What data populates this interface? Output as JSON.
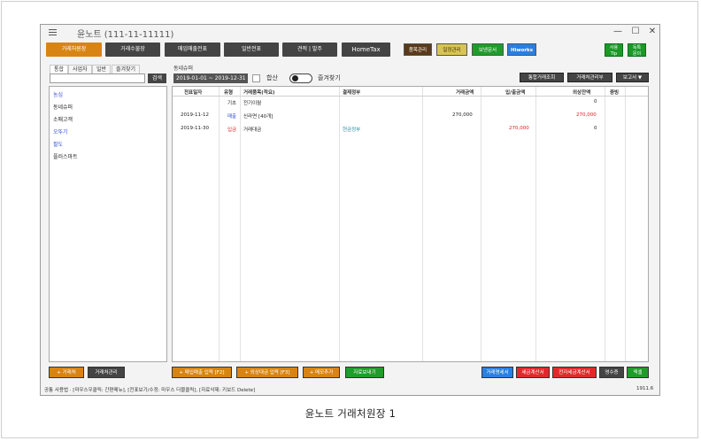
{
  "window": {
    "title": "윤노트 (111-11-11111)",
    "controls": [
      "—",
      "☐",
      "✕"
    ]
  },
  "nav_tabs": [
    {
      "label": "거래처원장",
      "active": true
    },
    {
      "label": "거래수불장",
      "active": false
    },
    {
      "label": "매입매출전표",
      "active": false
    },
    {
      "label": "일반전표",
      "active": false
    },
    {
      "label": "견적 | 발주",
      "active": false
    },
    {
      "label": "HomeTax",
      "active": false
    }
  ],
  "quick_buttons": [
    {
      "label": "품목관리",
      "color": "#5a3a1a",
      "text_color": "#ffffff"
    },
    {
      "label": "일정관리",
      "color": "#d8c454",
      "text_color": "#3a2a00"
    },
    {
      "label": "보낸문서",
      "color": "#1f9c2a",
      "text_color": "#ffffff"
    },
    {
      "label": "Hiworks",
      "color": "#2a7fe0",
      "text_color": "#ffffff"
    }
  ],
  "side_buttons": [
    {
      "line1": "사용",
      "line2": "Tip"
    },
    {
      "line1": "독특",
      "line2": "문의"
    }
  ],
  "left_tabs": [
    "통합",
    "사업자",
    "일반",
    "즐겨찾기"
  ],
  "search": {
    "placeholder": "",
    "button": "검색"
  },
  "partners": [
    {
      "name": "농심",
      "highlight": true
    },
    {
      "name": "동네슈퍼",
      "highlight": false
    },
    {
      "name": "소매고객",
      "highlight": false
    },
    {
      "name": "오뚜기",
      "highlight": true
    },
    {
      "name": "팔도",
      "highlight": true
    },
    {
      "name": "플러스마트",
      "highlight": false
    }
  ],
  "selected_partner": "동네슈퍼",
  "date_range": "2019-01-01 ~ 2019-12-31",
  "filter": {
    "hapsan_label": "합산",
    "favorite_label": "즐겨찾기"
  },
  "right_buttons": [
    "통합거래조회",
    "거래처관리부",
    "보고서 ▼"
  ],
  "table": {
    "columns": [
      "전표일자",
      "유형",
      "거래품목(적요)",
      "결제정부",
      "거래금액",
      "입/출금액",
      "외상잔액",
      "증빙"
    ],
    "rows": [
      {
        "date": "",
        "type": "기초",
        "type_color": "#333333",
        "item": "전기이월",
        "payment": "",
        "amount": "",
        "inout": "",
        "balance": "0",
        "balance_color": "#333333",
        "proof": ""
      },
      {
        "date": "2019-11-12",
        "type": "매출",
        "type_color": "#2f4bd6",
        "item": "신라면 [40개]",
        "payment": "",
        "amount": "270,000",
        "inout": "",
        "balance": "270,000",
        "balance_color": "#e02020",
        "proof": ""
      },
      {
        "date": "2019-11-30",
        "type": "입금",
        "type_color": "#e02020",
        "item": "거래대금",
        "payment": "현금정부",
        "amount": "",
        "inout": "270,000",
        "balance": "0",
        "balance_color": "#333333",
        "proof": ""
      }
    ]
  },
  "bottom_left_buttons": [
    {
      "label": "+ 거래처",
      "color": "#d88414"
    },
    {
      "label": "거래처관리",
      "color": "#444444"
    }
  ],
  "bottom_mid_buttons": [
    {
      "label": "+ 매입매출 입력 [F2]",
      "color": "#d88414"
    },
    {
      "label": "+ 외상대금 입력 [F3]",
      "color": "#d88414"
    },
    {
      "label": "+ 메모추가",
      "color": "#d88414"
    },
    {
      "label": "자료보내기",
      "color": "#1f9c2a"
    }
  ],
  "bottom_right_buttons": [
    {
      "label": "거래명세서",
      "color": "#2a7fe0"
    },
    {
      "label": "세금계산서",
      "color": "#e02a2a"
    },
    {
      "label": "전자세금계산서",
      "color": "#e02a2a"
    },
    {
      "label": "영수증",
      "color": "#444444"
    },
    {
      "label": "엑셀",
      "color": "#1f9c2a"
    }
  ],
  "status": {
    "left": "공통 사용법 ·  [마우스우클릭: 간편메뉴],   [전표보기/수정: 마우스 더블클릭],   [자료삭제: 키보드 Delete]",
    "version": "1911.6"
  },
  "caption": "윤노트 거래처원장 1"
}
